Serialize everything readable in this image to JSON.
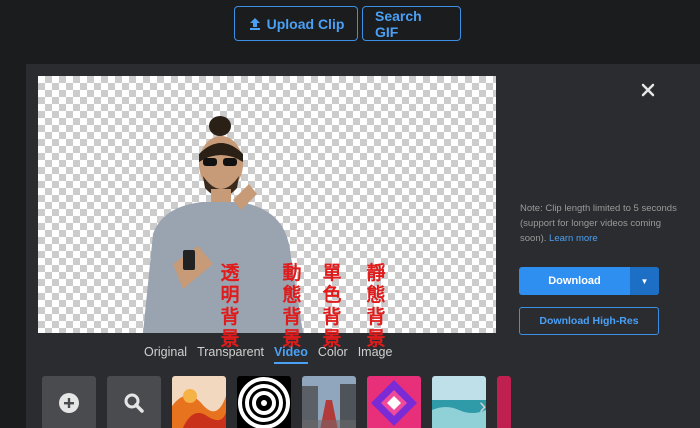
{
  "top_buttons": {
    "upload_label": "Upload Clip",
    "search_label": "Search GIF"
  },
  "overlay_labels": [
    "透明背景",
    "動態背景",
    "單色背景",
    "靜態背景"
  ],
  "tabs": [
    {
      "label": "Original",
      "active": false
    },
    {
      "label": "Transparent",
      "active": false
    },
    {
      "label": "Video",
      "active": true
    },
    {
      "label": "Color",
      "active": false
    },
    {
      "label": "Image",
      "active": false
    }
  ],
  "sidebar": {
    "note_text": "Note: Clip length limited to 5 seconds (support for longer videos coming soon). ",
    "note_link": "Learn more",
    "download_label": "Download",
    "download_hr_label": "Download High-Res"
  },
  "colors": {
    "accent": "#2f8ff0",
    "overlay_text": "#e01b1b",
    "panel": "#2b2c2f",
    "background": "#1b1c1e"
  },
  "icons": {
    "upload": "upload-icon",
    "close": "close-icon",
    "add": "plus-icon",
    "search": "magnifier-icon"
  }
}
